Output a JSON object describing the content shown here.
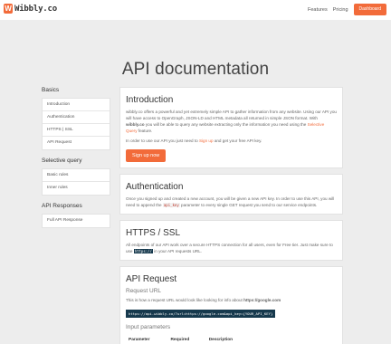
{
  "brand": {
    "logo_letter": "W",
    "name": "Wibbly.co"
  },
  "nav": {
    "features": "Features",
    "pricing": "Pricing",
    "dashboard": "Dashboard"
  },
  "hero": {
    "title": "API documentation"
  },
  "sidebar": {
    "basics": {
      "title": "Basics",
      "items": [
        "Introduction",
        "Authentication",
        "HTTPS | SSL",
        "API Request"
      ]
    },
    "selective": {
      "title": "Selective query",
      "items": [
        "Basic rules",
        "Inner rules"
      ]
    },
    "responses": {
      "title": "API Responses",
      "items": [
        "Full API Response"
      ]
    }
  },
  "intro": {
    "title": "Introduction",
    "p1_a": "wibbly.co offers a powerful and yet extremely simple API to gather information from any website. Using our API you will have access to OpenGraph, JSON-LD and HTML metadata all returned in simple JSON format. With ",
    "p1_bold": "wibbly.co",
    "p1_b": " you will be able to query any website extracting only the information you need using the ",
    "p1_link": "Selective Query",
    "p1_c": " feature.",
    "p2_a": "In order to use our API you just need to ",
    "p2_link": "Sign up",
    "p2_b": " and get your free API key.",
    "button": "Sign up now"
  },
  "auth": {
    "title": "Authentication",
    "p_a": "Once you signed up and created a new account, you will be given a new API key. In order to use this API, you will need to append the ",
    "p_code": "api_key",
    "p_b": " parameter to every single GET request you send to our service endpoints."
  },
  "https": {
    "title": "HTTPS / SSL",
    "p_a": "All endpoints of our API work over a secure HTTPS connection for all users, even for Free tier. Just make sure to use ",
    "p_code": "https://",
    "p_b": " in your API requests URL."
  },
  "request": {
    "title": "API Request",
    "url_heading": "Request URL",
    "p_a": "This is how a request URL would look like looking for info about ",
    "p_bold": "https://google.com",
    "url": "https://api.wibbly.co/?url=https://google.com&api_key={YOUR_API_KEY}",
    "params_heading": "Input parameters",
    "columns": [
      "Parameter",
      "Required",
      "Description"
    ]
  }
}
